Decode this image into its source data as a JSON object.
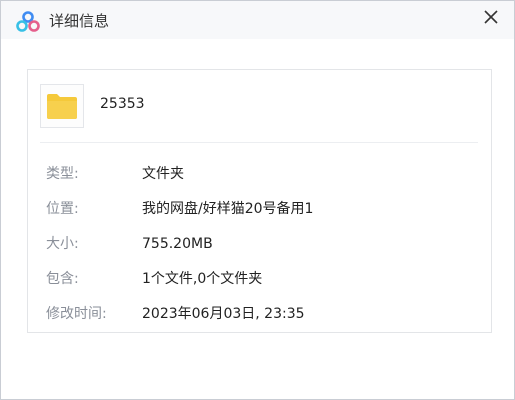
{
  "window": {
    "title": "详细信息",
    "app_icon": "baidu-netdisk-cloud-icon",
    "close_icon": "close-icon"
  },
  "file": {
    "icon": "folder-icon",
    "name": "25353"
  },
  "details": [
    {
      "label": "类型:",
      "value": "文件夹"
    },
    {
      "label": "位置:",
      "value": "我的网盘/好样猫20号备用1"
    },
    {
      "label": "大小:",
      "value": "755.20MB"
    },
    {
      "label": "包含:",
      "value": "1个文件,0个文件夹"
    },
    {
      "label": "修改时间:",
      "value": "2023年06月03日, 23:35"
    }
  ],
  "colors": {
    "folder": "#f5c93a",
    "icon_blue": "#3f8cf2",
    "icon_cyan": "#38c0e6",
    "icon_pink": "#e55f8c"
  }
}
